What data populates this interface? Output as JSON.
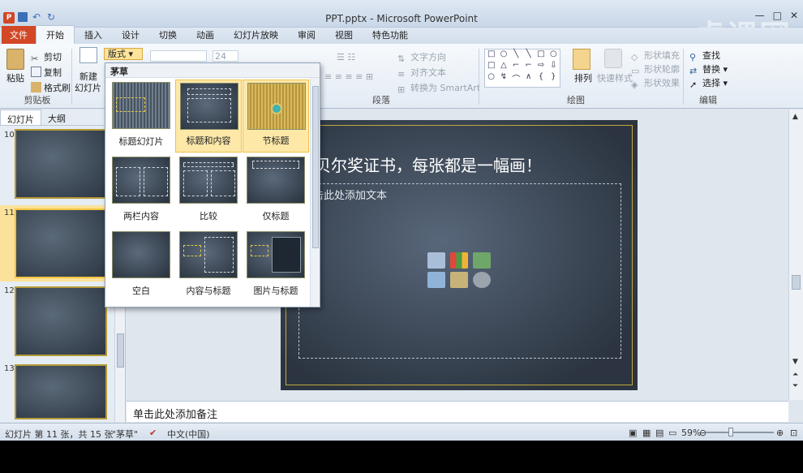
{
  "window": {
    "title": "PPT.pptx - Microsoft PowerPoint",
    "app_icon_letter": "P"
  },
  "watermark": "虎课网",
  "tabs": [
    "文件",
    "开始",
    "插入",
    "设计",
    "切换",
    "动画",
    "幻灯片放映",
    "审阅",
    "视图",
    "特色功能"
  ],
  "ribbon": {
    "clipboard": {
      "paste": "粘贴",
      "cut": "剪切",
      "copy": "复制",
      "format_painter": "格式刷",
      "label": "剪贴板"
    },
    "slides": {
      "new_slide_line1": "新建",
      "new_slide_line2": "幻灯片",
      "layout": "版式"
    },
    "font": {
      "size": "24"
    },
    "paragraph": {
      "text_direction": "文字方向",
      "align_text": "对齐文本",
      "smartart": "转换为 SmartArt",
      "label": "段落"
    },
    "drawing": {
      "arrange": "排列",
      "quick_styles": "快速样式",
      "shape_fill": "形状填充",
      "shape_outline": "形状轮廓",
      "shape_effects": "形状效果",
      "label": "绘图"
    },
    "editing": {
      "find": "查找",
      "replace": "替换",
      "select": "选择",
      "label": "编辑"
    }
  },
  "left_panel": {
    "tab_slides": "幻灯片",
    "tab_outline": "大纲",
    "close": "×",
    "slide_numbers": [
      "10",
      "11",
      "12",
      "13"
    ],
    "selected": "11"
  },
  "layout_menu": {
    "theme_name": "茅草",
    "items": [
      {
        "label": "标题幻灯片",
        "highlighted": false
      },
      {
        "label": "标题和内容",
        "highlighted": true
      },
      {
        "label": "节标题",
        "highlighted": true
      },
      {
        "label": "两栏内容",
        "highlighted": false
      },
      {
        "label": "比较",
        "highlighted": false
      },
      {
        "label": "仅标题",
        "highlighted": false
      },
      {
        "label": "空白",
        "highlighted": false
      },
      {
        "label": "内容与标题",
        "highlighted": false
      },
      {
        "label": "图片与标题",
        "highlighted": false
      }
    ]
  },
  "slide": {
    "title": "贝尔奖证书，每张都是一幅画！",
    "content_placeholder": "单击此处添加文本"
  },
  "notes_placeholder": "单击此处添加备注",
  "status": {
    "slide_info": "幻灯片 第 11 张，共 15 张",
    "theme": "\"茅草\"",
    "language": "中文(中国)",
    "zoom": "59%"
  },
  "colors": {
    "file_tab": "#d24726",
    "highlight": "#fde8a8",
    "slide_border": "#c2a93a"
  }
}
